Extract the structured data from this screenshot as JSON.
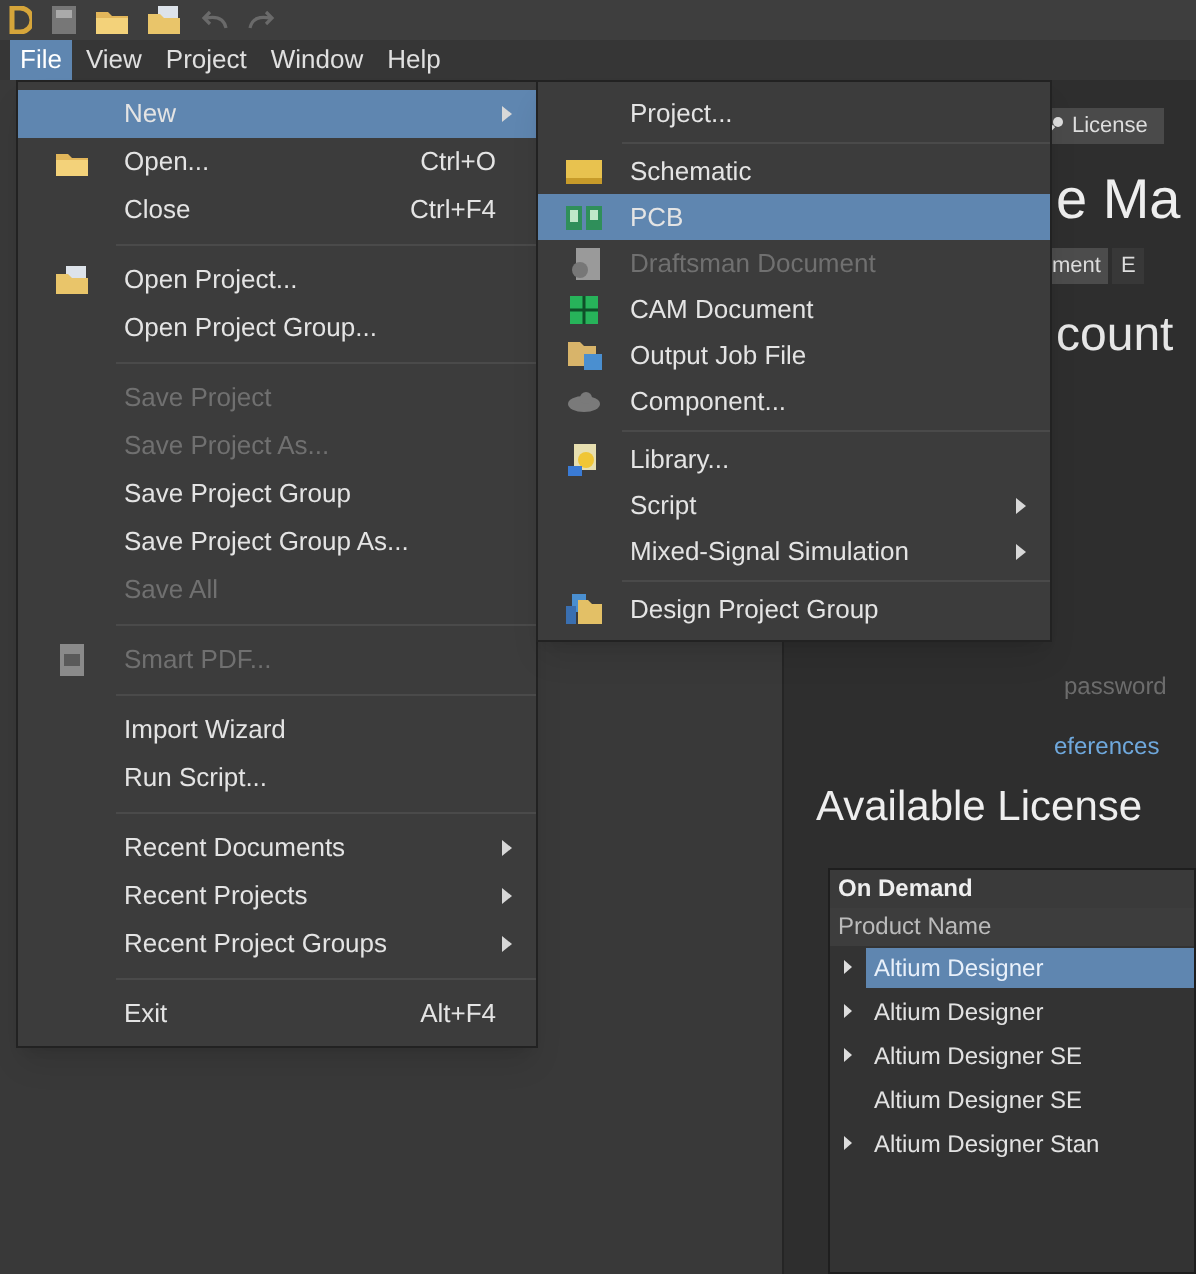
{
  "menu_bar": [
    {
      "label": "File",
      "selected": true
    },
    {
      "label": "View",
      "selected": false
    },
    {
      "label": "Project",
      "selected": false
    },
    {
      "label": "Window",
      "selected": false
    },
    {
      "label": "Help",
      "selected": false
    }
  ],
  "file_menu": [
    {
      "kind": "item",
      "label": "New",
      "submenu": true,
      "selected": true,
      "disabled": false
    },
    {
      "kind": "item",
      "label": "Open...",
      "shortcut": "Ctrl+O",
      "selected": false,
      "disabled": false
    },
    {
      "kind": "item",
      "label": "Close",
      "shortcut": "Ctrl+F4",
      "selected": false,
      "disabled": false
    },
    {
      "kind": "separator"
    },
    {
      "kind": "item",
      "label": "Open Project...",
      "selected": false,
      "disabled": false
    },
    {
      "kind": "item",
      "label": "Open Project Group...",
      "selected": false,
      "disabled": false
    },
    {
      "kind": "separator"
    },
    {
      "kind": "item",
      "label": "Save Project",
      "selected": false,
      "disabled": true
    },
    {
      "kind": "item",
      "label": "Save Project As...",
      "selected": false,
      "disabled": true
    },
    {
      "kind": "item",
      "label": "Save Project Group",
      "selected": false,
      "disabled": false
    },
    {
      "kind": "item",
      "label": "Save Project Group As...",
      "selected": false,
      "disabled": false
    },
    {
      "kind": "item",
      "label": "Save All",
      "selected": false,
      "disabled": true
    },
    {
      "kind": "separator"
    },
    {
      "kind": "item",
      "label": "Smart PDF...",
      "selected": false,
      "disabled": true
    },
    {
      "kind": "separator"
    },
    {
      "kind": "item",
      "label": "Import Wizard",
      "selected": false,
      "disabled": false
    },
    {
      "kind": "item",
      "label": "Run Script...",
      "selected": false,
      "disabled": false
    },
    {
      "kind": "separator"
    },
    {
      "kind": "item",
      "label": "Recent Documents",
      "submenu": true,
      "selected": false,
      "disabled": false
    },
    {
      "kind": "item",
      "label": "Recent Projects",
      "submenu": true,
      "selected": false,
      "disabled": false
    },
    {
      "kind": "item",
      "label": "Recent Project Groups",
      "submenu": true,
      "selected": false,
      "disabled": false
    },
    {
      "kind": "separator"
    },
    {
      "kind": "item",
      "label": "Exit",
      "shortcut": "Alt+F4",
      "selected": false,
      "disabled": false
    }
  ],
  "new_submenu": [
    {
      "kind": "item",
      "label": "Project...",
      "selected": false,
      "disabled": false
    },
    {
      "kind": "separator"
    },
    {
      "kind": "item",
      "label": "Schematic",
      "selected": false,
      "disabled": false
    },
    {
      "kind": "item",
      "label": "PCB",
      "selected": true,
      "disabled": false
    },
    {
      "kind": "item",
      "label": "Draftsman Document",
      "selected": false,
      "disabled": true
    },
    {
      "kind": "item",
      "label": "CAM Document",
      "selected": false,
      "disabled": false
    },
    {
      "kind": "item",
      "label": "Output Job File",
      "selected": false,
      "disabled": false
    },
    {
      "kind": "item",
      "label": "Component...",
      "selected": false,
      "disabled": false
    },
    {
      "kind": "separator"
    },
    {
      "kind": "item",
      "label": "Library...",
      "selected": false,
      "disabled": false
    },
    {
      "kind": "item",
      "label": "Script",
      "submenu": true,
      "selected": false,
      "disabled": false
    },
    {
      "kind": "item",
      "label": "Mixed-Signal Simulation",
      "submenu": true,
      "selected": false,
      "disabled": false
    },
    {
      "kind": "separator"
    },
    {
      "kind": "item",
      "label": "Design Project Group",
      "selected": false,
      "disabled": false
    }
  ],
  "license_page": {
    "tab": "License",
    "title": "e Ma",
    "subtabs": [
      {
        "label": "ment",
        "selected": true
      },
      {
        "label": "E",
        "selected": false
      }
    ],
    "section_title": "count",
    "password_text": "password",
    "link": "eferences",
    "available_title": "Available License",
    "table": {
      "group": "On Demand",
      "column": "Product Name",
      "rows": [
        {
          "name": "Altium Designer",
          "expandable": true,
          "selected": true
        },
        {
          "name": "Altium Designer",
          "expandable": true,
          "selected": false
        },
        {
          "name": "Altium Designer SE",
          "expandable": true,
          "selected": false
        },
        {
          "name": "Altium Designer SE",
          "expandable": false,
          "selected": false
        },
        {
          "name": "Altium Designer Stan",
          "expandable": true,
          "selected": false
        }
      ]
    }
  }
}
